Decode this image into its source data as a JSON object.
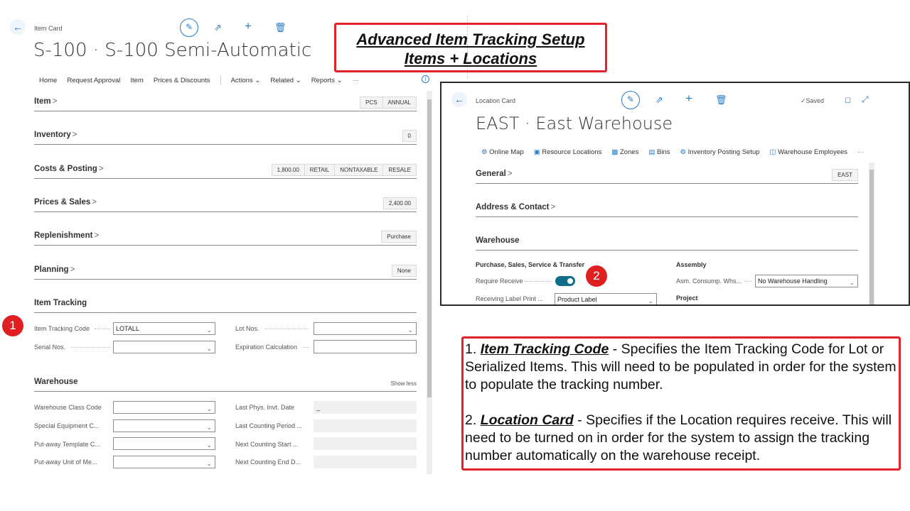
{
  "item_card": {
    "breadcrumb": "Item Card",
    "title": "S-100 · S-100 Semi-Automatic",
    "actions": [
      "Home",
      "Request Approval",
      "Item",
      "Prices & Discounts"
    ],
    "menus": [
      "Actions",
      "Related",
      "Reports"
    ],
    "more": "···",
    "sections": [
      {
        "title": "Item",
        "chevron": ">",
        "pills": [
          "PCS",
          "ANNUAL"
        ]
      },
      {
        "title": "Inventory",
        "chevron": ">",
        "pills": [
          "0"
        ]
      },
      {
        "title": "Costs & Posting",
        "chevron": ">",
        "pills": [
          "1,800.00",
          "RETAIL",
          "NONTAXABLE",
          "RESALE"
        ]
      },
      {
        "title": "Prices & Sales",
        "chevron": ">",
        "pills": [
          "2,400.00"
        ]
      },
      {
        "title": "Replenishment",
        "chevron": ">",
        "pills": [
          "Purchase"
        ]
      },
      {
        "title": "Planning",
        "chevron": ">",
        "pills": [
          "None"
        ]
      }
    ],
    "item_tracking": {
      "title": "Item Tracking",
      "item_tracking_code_label": "Item Tracking Code",
      "item_tracking_code_value": "LOTALL",
      "serial_nos_label": "Serial Nos.",
      "serial_nos_value": "",
      "lot_nos_label": "Lot Nos.",
      "lot_nos_value": "",
      "expiration_label": "Expiration Calculation",
      "expiration_value": ""
    },
    "warehouse": {
      "title": "Warehouse",
      "show_less": "Show less",
      "left_fields": [
        "Warehouse Class Code",
        "Special Equipment C...",
        "Put-away Template C...",
        "Put-away Unit of Me..."
      ],
      "right_fields": [
        "Last Phys. Invt. Date",
        "Last Counting Period ...",
        "Next Counting Start ...",
        "Next Counting End D..."
      ],
      "last_phys_invt_value": "_"
    }
  },
  "banner": {
    "line1": "Advanced Item Tracking Setup",
    "line2": "Items + Locations"
  },
  "badges": {
    "one": "1",
    "two": "2"
  },
  "location_card": {
    "breadcrumb": "Location Card",
    "saved": "Saved",
    "title": "EAST · East Warehouse",
    "actions": [
      "Online Map",
      "Resource Locations",
      "Zones",
      "Bins",
      "Inventory Posting Setup",
      "Warehouse Employees"
    ],
    "more": "···",
    "general": {
      "title": "General",
      "chevron": ">",
      "pill": "EAST"
    },
    "address": {
      "title": "Address & Contact",
      "chevron": ">"
    },
    "warehouse": {
      "title": "Warehouse",
      "purchase_heading": "Purchase, Sales, Service & Transfer",
      "require_receive_label": "Require Receive",
      "require_receive_on": true,
      "receiving_label_print_label": "Receiving Label Print ...",
      "receiving_label_print_value": "Product Label",
      "assembly_heading": "Assembly",
      "asm_consump_label": "Asm. Consump. Whs...",
      "asm_consump_value": "No Warehouse Handling",
      "project_heading": "Project"
    }
  },
  "notes": {
    "n1_prefix": "1. ",
    "n1_term": "Item Tracking Code",
    "n1_text": " - Specifies the Item Tracking Code for Lot or Serialized Items. This will need to be populated in order for the system to populate the tracking number.",
    "n2_prefix": "2. ",
    "n2_term": "Location Card",
    "n2_text": " - Specifies if the Location requires receive. This will need to be turned on in order for the system to assign the tracking number automatically on the warehouse receipt."
  },
  "colors": {
    "accent": "#2b7cc7",
    "toggle": "#0f6e8a",
    "red": "#e02020"
  }
}
